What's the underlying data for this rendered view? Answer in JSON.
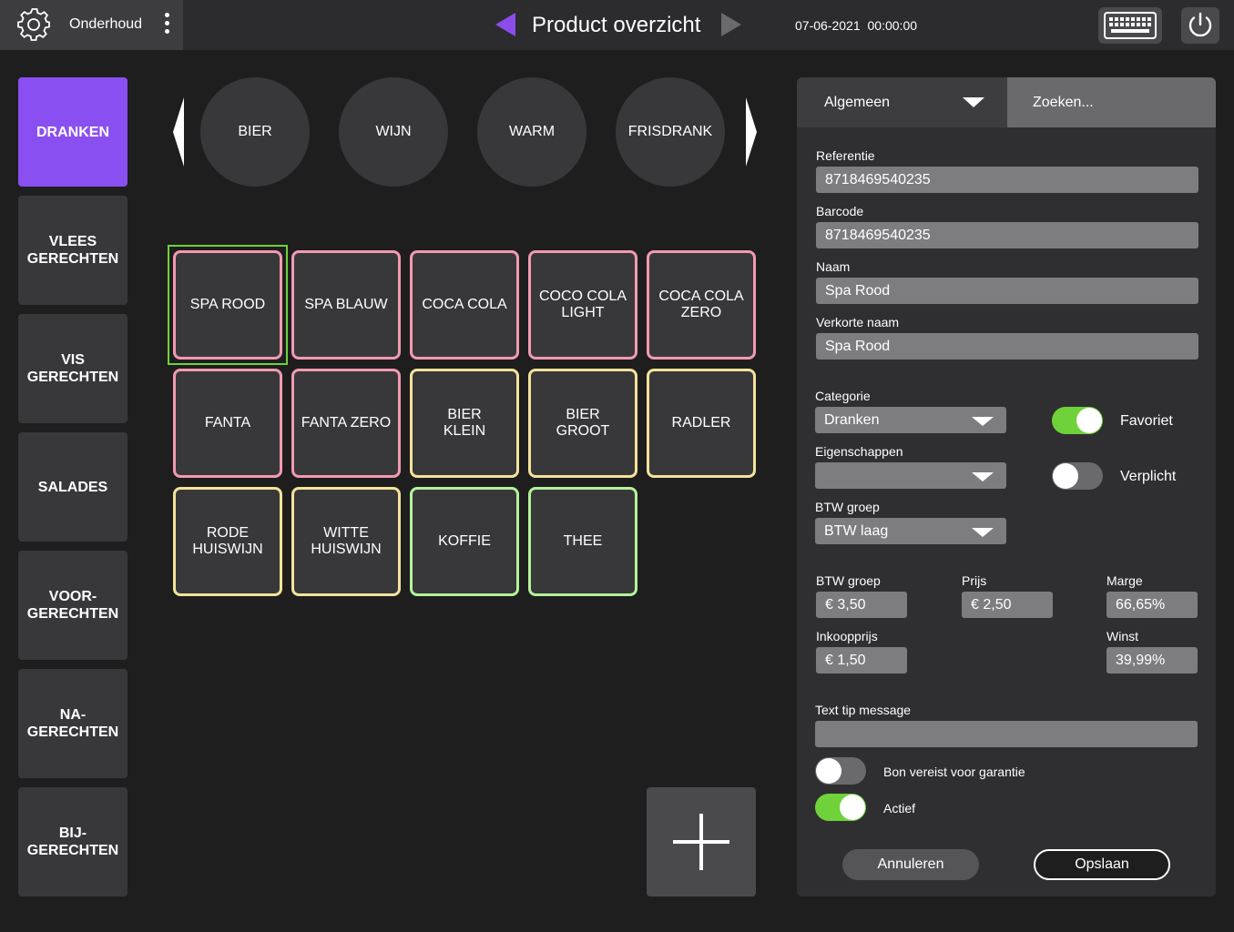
{
  "topbar": {
    "menu_label": "Onderhoud",
    "title": "Product overzicht",
    "date": "07-06-2021",
    "time": "00:00:00",
    "accent_color": "#8b4dea"
  },
  "categories": [
    {
      "label": "DRANKEN",
      "active": true
    },
    {
      "label": "VLEES\nGERECHTEN"
    },
    {
      "label": "VIS\nGERECHTEN"
    },
    {
      "label": "SALADES"
    },
    {
      "label": "VOOR-\nGERECHTEN"
    },
    {
      "label": "NA-\nGERECHTEN"
    },
    {
      "label": "BIJ-\nGERECHTEN"
    }
  ],
  "subcategories": [
    "BIER",
    "WIJN",
    "WARM",
    "FRISDRANK"
  ],
  "products": [
    {
      "label": "SPA ROOD",
      "border": "pink",
      "selected": true
    },
    {
      "label": "SPA BLAUW",
      "border": "pink"
    },
    {
      "label": "COCA COLA",
      "border": "pink"
    },
    {
      "label": "COCO COLA\nLIGHT",
      "border": "pink"
    },
    {
      "label": "COCA COLA\nZERO",
      "border": "pink"
    },
    {
      "label": "FANTA",
      "border": "pink"
    },
    {
      "label": "FANTA ZERO",
      "border": "pink"
    },
    {
      "label": "BIER\nKLEIN",
      "border": "yellow"
    },
    {
      "label": "BIER\nGROOT",
      "border": "yellow"
    },
    {
      "label": "RADLER",
      "border": "yellow"
    },
    {
      "label": "RODE\nHUISWIJN",
      "border": "yellow"
    },
    {
      "label": "WITTE\nHUISWIJN",
      "border": "yellow"
    },
    {
      "label": "KOFFIE",
      "border": "green"
    },
    {
      "label": "THEE",
      "border": "green"
    }
  ],
  "border_colors": {
    "pink": "#f29ab0",
    "yellow": "#f4e29a",
    "green": "#b5f29a"
  },
  "panel": {
    "tab_general": "Algemeen",
    "tab_search": "Zoeken...",
    "referentie": {
      "label": "Referentie",
      "value": "8718469540235"
    },
    "barcode": {
      "label": "Barcode",
      "value": "8718469540235"
    },
    "naam": {
      "label": "Naam",
      "value": "Spa Rood"
    },
    "verkorte_naam": {
      "label": "Verkorte naam",
      "value": "Spa Rood"
    },
    "categorie": {
      "label": "Categorie",
      "value": "Dranken"
    },
    "eigenschappen": {
      "label": "Eigenschappen",
      "value": ""
    },
    "btw_groep": {
      "label": "BTW groep",
      "value": "BTW laag"
    },
    "favoriet": {
      "label": "Favoriet",
      "on": true
    },
    "verplicht": {
      "label": "Verplicht",
      "on": false
    },
    "prijs_btw": {
      "label": "BTW groep",
      "value": "€ 3,50"
    },
    "prijs": {
      "label": "Prijs",
      "value": "€ 2,50"
    },
    "marge": {
      "label": "Marge",
      "value": "66,65%"
    },
    "inkoopprijs": {
      "label": "Inkoopprijs",
      "value": "€ 1,50"
    },
    "winst": {
      "label": "Winst",
      "value": "39,99%"
    },
    "text_tip": {
      "label": "Text tip message",
      "value": ""
    },
    "bon_vereist": {
      "label": "Bon vereist voor garantie",
      "on": false
    },
    "actief": {
      "label": "Actief",
      "on": true
    },
    "cancel_label": "Annuleren",
    "save_label": "Opslaan",
    "toggle_on_color": "#6fd23a"
  }
}
